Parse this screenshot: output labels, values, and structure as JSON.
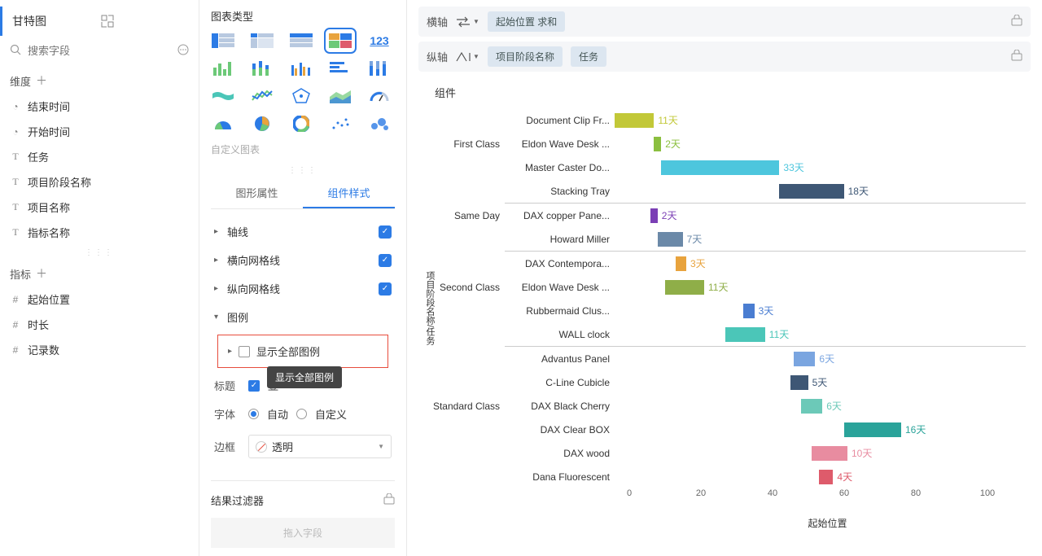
{
  "view": {
    "name": "甘特图",
    "search_placeholder": "搜索字段"
  },
  "dimensions": {
    "title": "维度",
    "items": [
      {
        "icon": "clock",
        "label": "结束时间"
      },
      {
        "icon": "clock",
        "label": "开始时间"
      },
      {
        "icon": "T",
        "label": "任务"
      },
      {
        "icon": "T",
        "label": "项目阶段名称"
      },
      {
        "icon": "T",
        "label": "项目名称"
      },
      {
        "icon": "T",
        "label": "指标名称"
      }
    ]
  },
  "measures": {
    "title": "指标",
    "items": [
      {
        "icon": "hash",
        "label": "起始位置"
      },
      {
        "icon": "hash",
        "label": "时长"
      },
      {
        "icon": "hash2",
        "label": "记录数"
      }
    ]
  },
  "chart_types": {
    "title": "图表类型",
    "custom_label": "自定义图表",
    "number_label": "123"
  },
  "tabs": {
    "graphic_props": "图形属性",
    "component_style": "组件样式"
  },
  "style_panel": {
    "axis": "轴线",
    "h_grid": "横向网格线",
    "v_grid": "纵向网格线",
    "legend": "图例",
    "show_all_legend": "显示全部图例",
    "tooltip": "显示全部图例",
    "title_label": "标题",
    "title_text": "显",
    "font_label": "字体",
    "font_auto": "自动",
    "font_custom": "自定义",
    "border_label": "边框",
    "border_value": "透明"
  },
  "result_filter": {
    "title": "结果过滤器",
    "drop_hint": "拖入字段"
  },
  "axis_config": {
    "h_axis": "横轴",
    "h_pill": "起始位置  求和",
    "v_axis": "纵轴",
    "v_pill1": "项目阶段名称",
    "v_pill2": "任务"
  },
  "chart": {
    "title": "组件",
    "y_group_label": "项目阶段名称/任务",
    "x_title": "起始位置",
    "x_ticks": [
      "0",
      "20",
      "40",
      "60",
      "80",
      "100"
    ]
  },
  "chart_data": {
    "type": "bar",
    "orientation": "horizontal",
    "title": "组件",
    "xlabel": "起始位置",
    "ylabel": "项目阶段名称/任务",
    "xlim": [
      0,
      100
    ],
    "groups": [
      {
        "name": "First Class",
        "tasks": [
          {
            "name": "Document Clip Fr...",
            "start": 0,
            "duration": 11,
            "label": "11天",
            "color": "#c2c838"
          },
          {
            "name": "Eldon Wave Desk ...",
            "start": 11,
            "duration": 2,
            "label": "2天",
            "color": "#8bbf3f"
          },
          {
            "name": "Master Caster Do...",
            "start": 13,
            "duration": 33,
            "label": "33天",
            "color": "#4dc6dd"
          },
          {
            "name": "Stacking Tray",
            "start": 46,
            "duration": 18,
            "label": "18天",
            "color": "#3e5775"
          }
        ]
      },
      {
        "name": "Same Day",
        "tasks": [
          {
            "name": "DAX copper Pane...",
            "start": 10,
            "duration": 2,
            "label": "2天",
            "color": "#7b3fb5"
          },
          {
            "name": "Howard Miller",
            "start": 12,
            "duration": 7,
            "label": "7天",
            "color": "#6b89a8"
          }
        ]
      },
      {
        "name": "Second Class",
        "tasks": [
          {
            "name": "DAX Contempora...",
            "start": 17,
            "duration": 3,
            "label": "3天",
            "color": "#e8a33d"
          },
          {
            "name": "Eldon Wave Desk ...",
            "start": 14,
            "duration": 11,
            "label": "11天",
            "color": "#8fae48"
          },
          {
            "name": "Rubbermaid Clus...",
            "start": 36,
            "duration": 3,
            "label": "3天",
            "color": "#4a7dd1"
          },
          {
            "name": "WALL clock",
            "start": 31,
            "duration": 11,
            "label": "11天",
            "color": "#4bc6b8"
          }
        ]
      },
      {
        "name": "Standard Class",
        "tasks": [
          {
            "name": "Advantus Panel",
            "start": 50,
            "duration": 6,
            "label": "6天",
            "color": "#7aa5e0"
          },
          {
            "name": "C-Line Cubicle",
            "start": 49,
            "duration": 5,
            "label": "5天",
            "color": "#3e5775"
          },
          {
            "name": "DAX Black Cherry",
            "start": 52,
            "duration": 6,
            "label": "6天",
            "color": "#6cc9b8"
          },
          {
            "name": "DAX Clear BOX",
            "start": 64,
            "duration": 16,
            "label": "16天",
            "color": "#2aa39a"
          },
          {
            "name": "DAX wood",
            "start": 55,
            "duration": 10,
            "label": "10天",
            "color": "#e88ca0"
          },
          {
            "name": "Dana Fluorescent",
            "start": 57,
            "duration": 4,
            "label": "4天",
            "color": "#de5b6b"
          }
        ]
      }
    ]
  }
}
